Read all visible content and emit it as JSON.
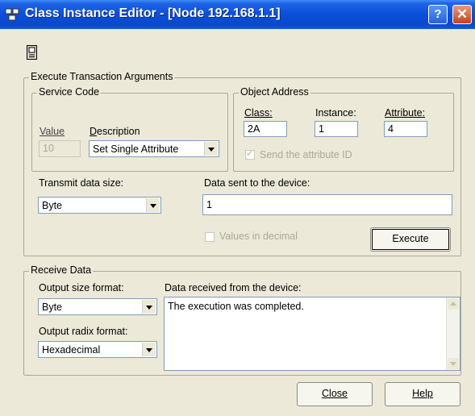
{
  "window": {
    "title": "Class Instance Editor - [Node 192.168.1.1]",
    "help_button": "?",
    "close_button": "✕"
  },
  "execute_args": {
    "group_label": "Execute Transaction Arguments",
    "service_code": {
      "group_label": "Service Code",
      "value_label": "Value",
      "value": "10",
      "description_label": "Description",
      "description": "Set Single Attribute"
    },
    "object_address": {
      "group_label": "Object Address",
      "class_label": "Class:",
      "class_value": "2A",
      "instance_label": "Instance:",
      "instance_value": "1",
      "attribute_label": "Attribute:",
      "attribute_value": "4",
      "send_attr_label": "Send the attribute ID",
      "send_attr_checked": true
    },
    "transmit_label": "Transmit data size:",
    "transmit_value": "Byte",
    "data_sent_label": "Data sent to the device:",
    "data_sent_value": "1",
    "values_decimal_label": "Values in decimal",
    "values_decimal_checked": false,
    "execute_button": "Execute"
  },
  "receive": {
    "group_label": "Receive Data",
    "output_size_label": "Output size format:",
    "output_size_value": "Byte",
    "output_radix_label": "Output radix format:",
    "output_radix_value": "Hexadecimal",
    "data_received_label": "Data received from the device:",
    "data_received_text": "The execution was completed."
  },
  "footer": {
    "close_button": "Close",
    "help_button": "Help"
  },
  "colors": {
    "titlebar": "#0a4fd8",
    "dialog_bg": "#ece9d8",
    "group_border": "#aca899",
    "field_border": "#7f9db9",
    "disabled_text": "#aca899",
    "close_button": "#c9411a"
  }
}
